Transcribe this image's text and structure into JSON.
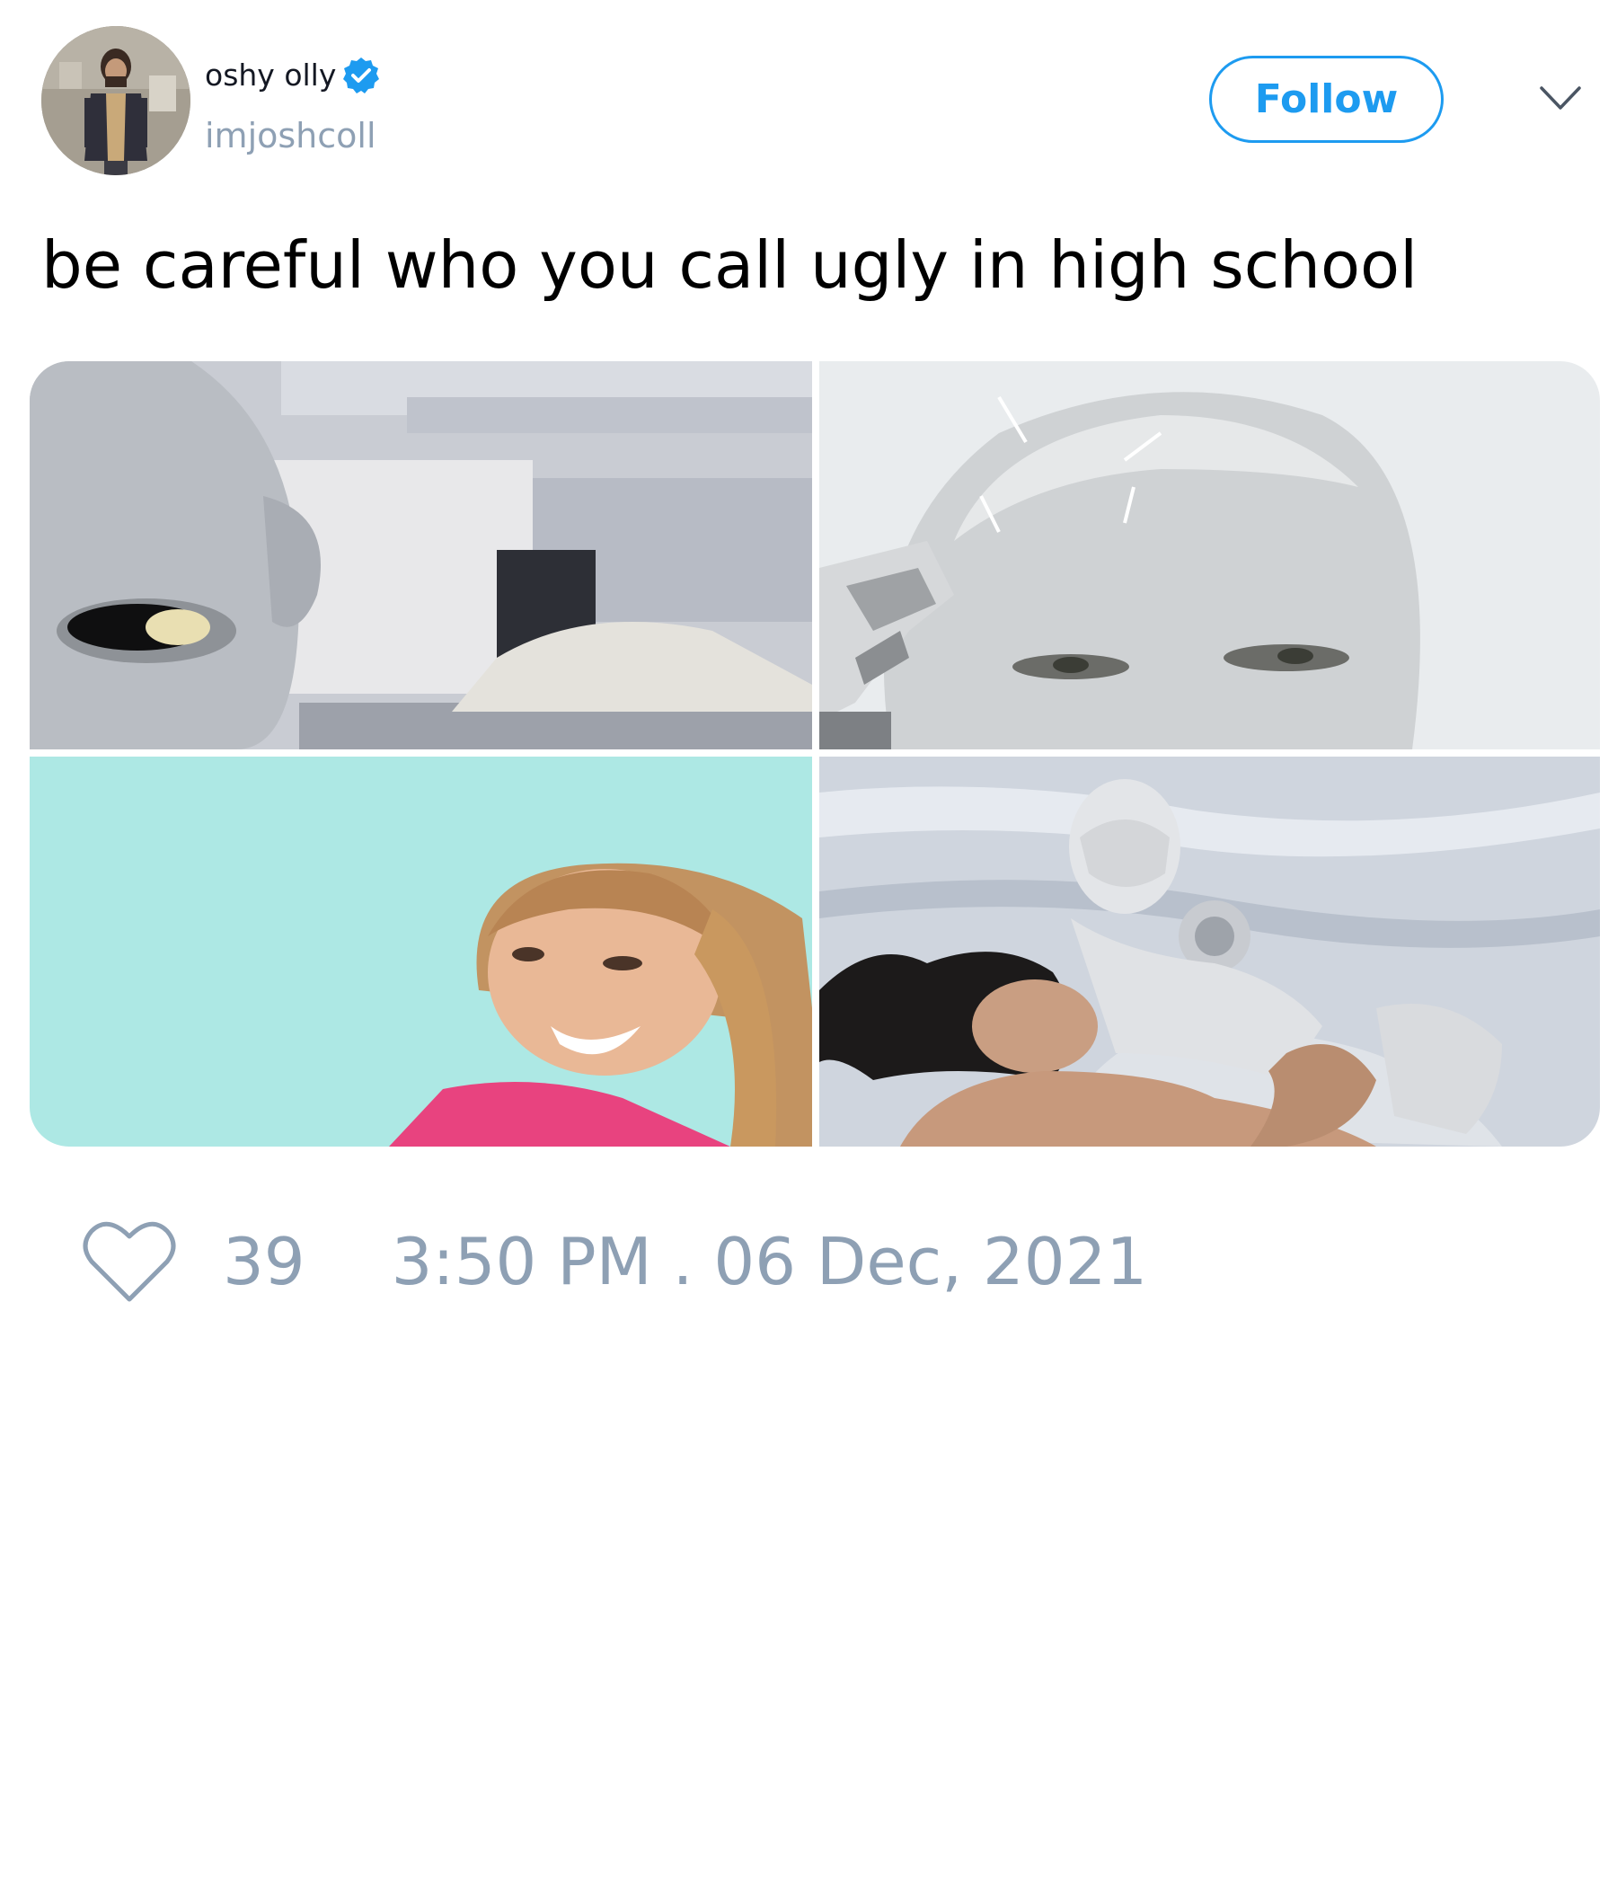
{
  "author": {
    "display_name": "oshy olly",
    "handle": "imjoshcoll",
    "verified": true,
    "avatar_icon": "profile-photo"
  },
  "actions": {
    "follow_label": "Follow",
    "menu_icon": "chevron-down-icon"
  },
  "tweet": {
    "text": "be careful who you call ugly in high school",
    "media": [
      {
        "name": "robot-face-closeup-photo"
      },
      {
        "name": "robot-head-touching-temple-photo"
      },
      {
        "name": "laughing-girl-photo"
      },
      {
        "name": "robot-and-woman-in-bed-photo"
      }
    ]
  },
  "footer": {
    "like_icon": "heart-icon",
    "like_count": "39",
    "timestamp": "3:50 PM . 06 Dec, 2021"
  },
  "colors": {
    "accent": "#1d9bf0",
    "muted_text": "#8ea0b4",
    "text": "#000000"
  }
}
